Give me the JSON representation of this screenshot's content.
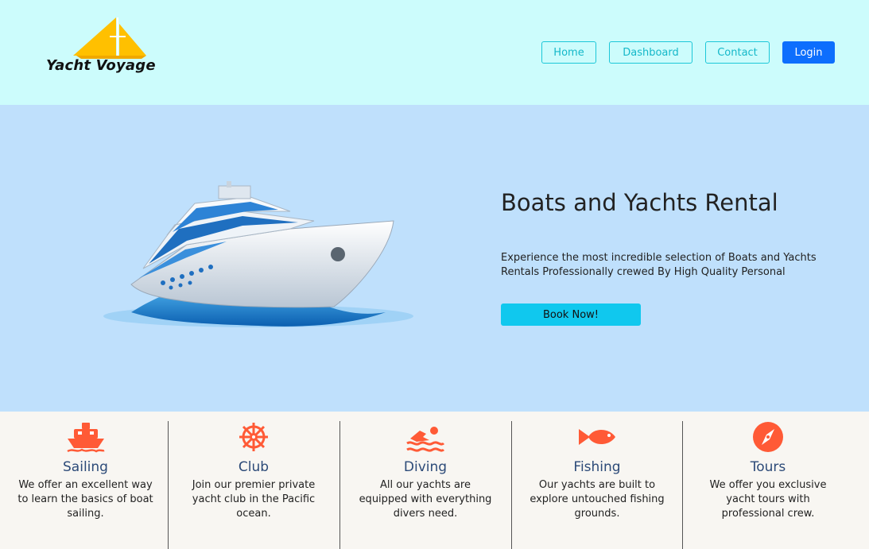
{
  "brand": {
    "name": "Yacht Voyage",
    "logo_icon": "sailboat-icon",
    "logo_color": "#ffc107"
  },
  "nav": {
    "home": "Home",
    "dashboard": "Dashboard",
    "contact": "Contact",
    "login": "Login"
  },
  "hero": {
    "title": "Boats and Yachts Rental",
    "description": "Experience the most incredible selection of Boats and Yachts Rentals Professionally crewed By High Quality Personal",
    "cta": "Book Now!",
    "image": "cruise-ship-illustration"
  },
  "features": [
    {
      "icon": "ship-icon",
      "title": "Sailing",
      "description": "We offer an excellent way to learn the basics of boat sailing."
    },
    {
      "icon": "ship-wheel-icon",
      "title": "Club",
      "description": "Join our premier private yacht club in the Pacific ocean."
    },
    {
      "icon": "swimmer-icon",
      "title": "Diving",
      "description": "All our yachts are equipped with everything divers need."
    },
    {
      "icon": "fish-icon",
      "title": "Fishing",
      "description": "Our yachts are built to explore untouched fishing grounds."
    },
    {
      "icon": "compass-icon",
      "title": "Tours",
      "description": "We offer you exclusive yacht tours with professional crew."
    }
  ],
  "colors": {
    "header_bg": "#ccfcfc",
    "hero_bg": "#bfe0fc",
    "accent": "#ff5a36",
    "cta": "#10c8ee",
    "login": "#0d6efd"
  }
}
